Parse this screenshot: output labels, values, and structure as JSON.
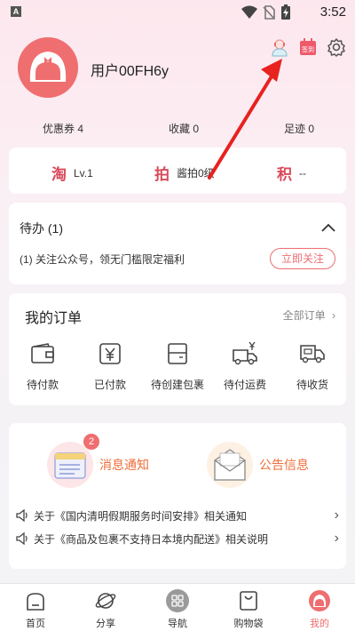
{
  "statusbar": {
    "left_badge": "A",
    "time": "3:52"
  },
  "profile": {
    "username": "用户00FH6y"
  },
  "top_icons": [
    "customer-service-icon",
    "sign-in-calendar-icon",
    "settings-gear-icon"
  ],
  "sign_in_label": "签到",
  "stats": {
    "coupons": "优惠券 4",
    "favorites": "收藏 0",
    "footprints": "足迹 0"
  },
  "levels": [
    {
      "char": "淘",
      "value": "Lv.1"
    },
    {
      "char": "拍",
      "value": "酱拍0级"
    },
    {
      "char": "积",
      "value": "--"
    }
  ],
  "todo": {
    "title": "待办 (1)",
    "desc": "(1) 关注公众号，领无门槛限定福利",
    "button": "立即关注"
  },
  "orders": {
    "title": "我的订单",
    "all_link": "全部订单",
    "items": [
      {
        "label": "待付款",
        "icon": "wallet-icon"
      },
      {
        "label": "已付款",
        "icon": "paid-yen-icon"
      },
      {
        "label": "待创建包裹",
        "icon": "package-box-icon"
      },
      {
        "label": "待付运费",
        "icon": "shipping-fee-truck-icon"
      },
      {
        "label": "待收货",
        "icon": "delivery-truck-icon"
      }
    ]
  },
  "notices": {
    "message_label": "消息通知",
    "message_badge": "2",
    "announce_label": "公告信息",
    "rows": [
      "关于《国内清明假期服务时间安排》相关通知",
      "关于《商品及包裹不支持日本境内配送》相关说明"
    ]
  },
  "tabs": [
    {
      "label": "首页",
      "icon": "home-icon",
      "active": false
    },
    {
      "label": "分享",
      "icon": "planet-icon",
      "active": false
    },
    {
      "label": "导航",
      "icon": "grid-nav-icon",
      "active": false
    },
    {
      "label": "购物袋",
      "icon": "shopping-bag-icon",
      "active": false
    },
    {
      "label": "我的",
      "icon": "profile-avatar-icon",
      "active": true
    }
  ],
  "colors": {
    "accent": "#ef6e70",
    "notice_orange": "#ef6e3a",
    "arrow": "#e8221f"
  }
}
